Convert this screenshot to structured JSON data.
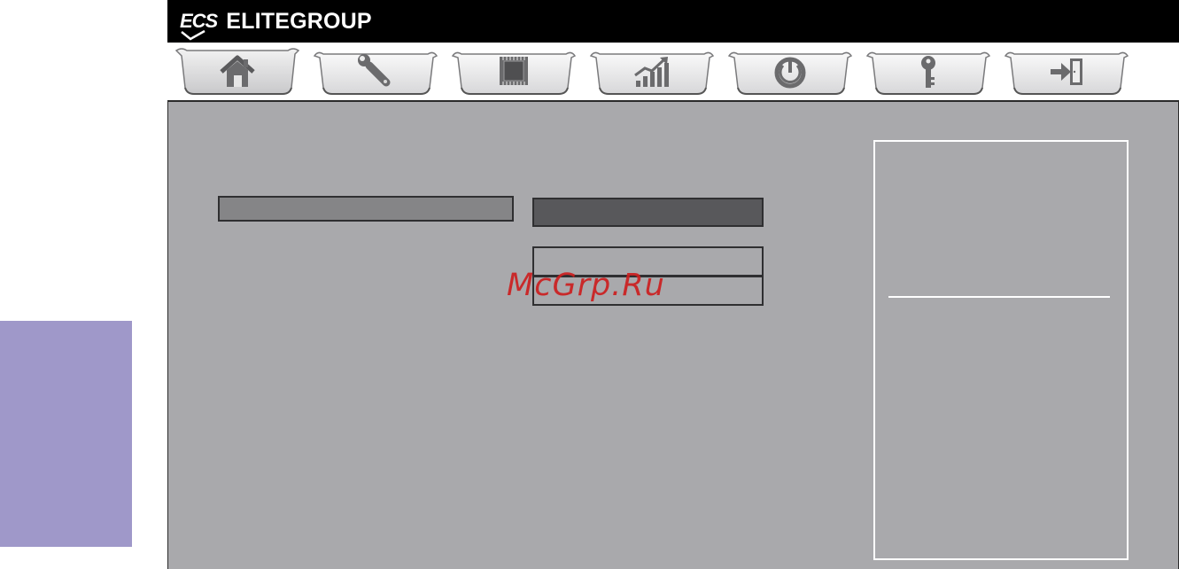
{
  "brand": {
    "logo_text": "ECS",
    "name": "ELITEGROUP"
  },
  "tabs": [
    {
      "icon": "home-icon",
      "active": true
    },
    {
      "icon": "wrench-icon",
      "active": false
    },
    {
      "icon": "chip-icon",
      "active": false
    },
    {
      "icon": "chart-icon",
      "active": false
    },
    {
      "icon": "power-icon",
      "active": false
    },
    {
      "icon": "key-icon",
      "active": false
    },
    {
      "icon": "exit-icon",
      "active": false
    }
  ],
  "setting": {
    "label": "",
    "value": ""
  },
  "options": [
    "",
    ""
  ],
  "help": {
    "text": ""
  },
  "watermark": "McGrp.Ru",
  "colors": {
    "panel": "#a9a9ac",
    "header": "#000000",
    "side_tab": "#9f98c9",
    "watermark": "#cc1f1f"
  }
}
